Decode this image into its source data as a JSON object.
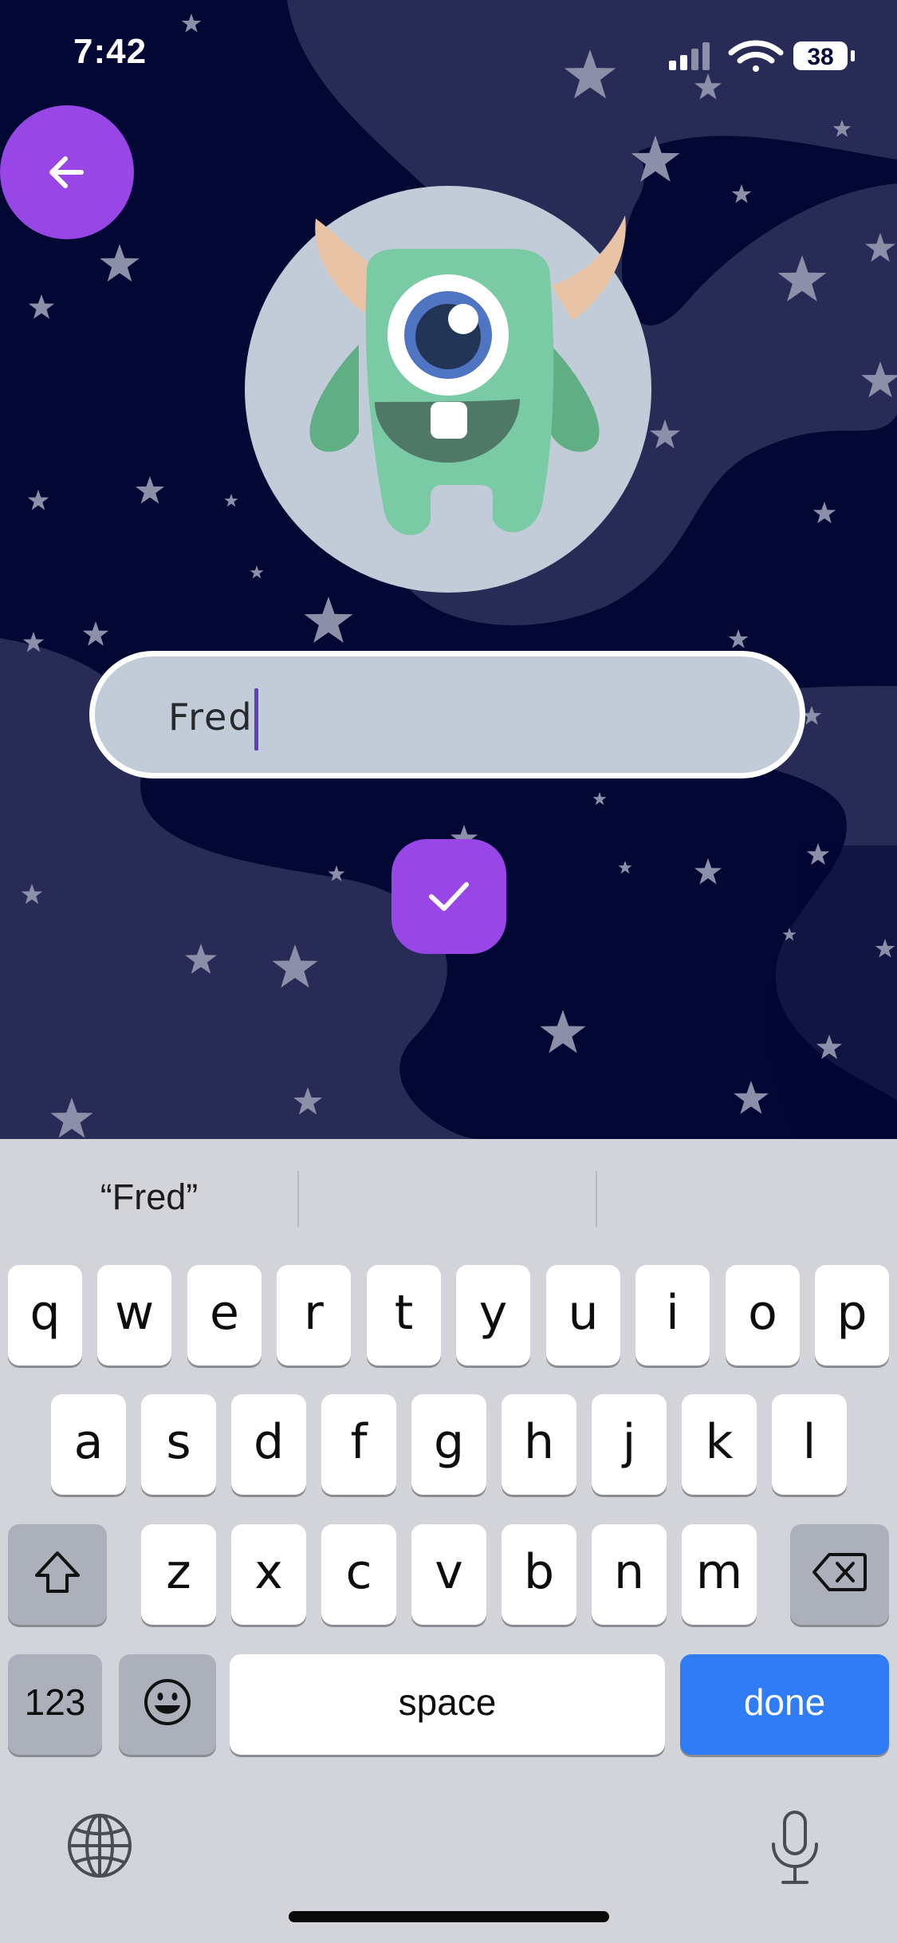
{
  "status_bar": {
    "time": "7:42",
    "battery": "38"
  },
  "colors": {
    "accent": "#9847e6",
    "background": "#030733",
    "field": "#c1ccd8",
    "done_key": "#2f7cf6"
  },
  "name_field": {
    "value": "Fred"
  },
  "keyboard": {
    "suggestion": "“Fred”",
    "row1": [
      "q",
      "w",
      "e",
      "r",
      "t",
      "y",
      "u",
      "i",
      "o",
      "p"
    ],
    "row2": [
      "a",
      "s",
      "d",
      "f",
      "g",
      "h",
      "j",
      "k",
      "l"
    ],
    "row3": [
      "z",
      "x",
      "c",
      "v",
      "b",
      "n",
      "m"
    ],
    "numbers_label": "123",
    "space_label": "space",
    "done_label": "done"
  },
  "icons": {
    "back": "arrow-left-icon",
    "confirm": "checkmark-icon",
    "shift": "shift-icon",
    "backspace": "backspace-icon",
    "emoji": "emoji-icon",
    "globe": "globe-icon",
    "mic": "microphone-icon"
  }
}
